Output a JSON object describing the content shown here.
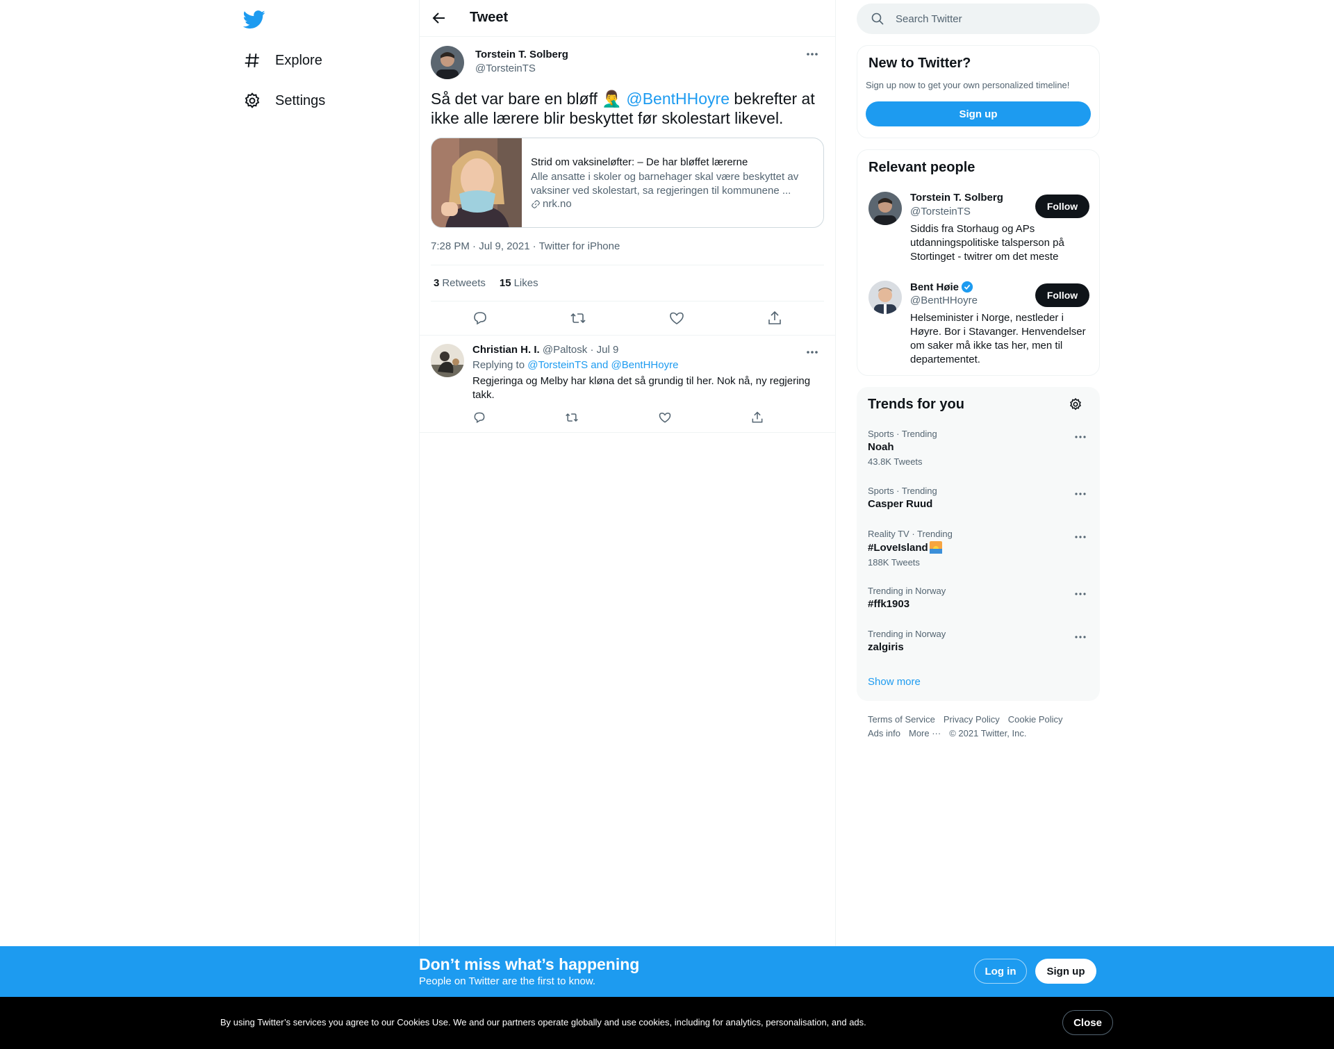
{
  "nav": {
    "logo": "twitter-bird-icon",
    "items": [
      {
        "label": "Explore",
        "icon": "hashtag-icon"
      },
      {
        "label": "Settings",
        "icon": "gear-icon"
      }
    ]
  },
  "header": {
    "title": "Tweet"
  },
  "tweet": {
    "author_name": "Torstein T. Solberg",
    "author_handle": "@TorsteinTS",
    "text_before": "Så det var bare en bløff 🤦‍♂️ ",
    "mention": "@BentHHoyre",
    "text_after": " bekrefter at ikke alle lærere blir beskyttet før skolestart likevel.",
    "card": {
      "title": "Strid om vaksineløfter: – De har bløffet lærerne",
      "description": "Alle ansatte i skoler og barnehager skal være beskyttet av vaksiner ved skolestart, sa regjeringen til kommunene ...",
      "domain": "nrk.no"
    },
    "time": "7:28 PM · Jul 9, 2021",
    "source": "Twitter for iPhone",
    "retweets_count": "3",
    "retweets_label": "Retweets",
    "likes_count": "15",
    "likes_label": "Likes"
  },
  "reply": {
    "author_name": "Christian H. I.",
    "author_handle": "@Paltosk",
    "date": "Jul 9",
    "replying_prefix": "Replying to ",
    "replying_to": "@TorsteinTS and @BentHHoyre",
    "text": "Regjeringa og Melby har kløna det så grundig til her. Nok nå, ny regjering takk."
  },
  "search": {
    "placeholder": "Search Twitter"
  },
  "new_to_twitter": {
    "title": "New to Twitter?",
    "subtitle": "Sign up now to get your own personalized timeline!",
    "signup_label": "Sign up"
  },
  "relevant_people": {
    "title": "Relevant people",
    "follow_label": "Follow",
    "people": [
      {
        "name": "Torstein T. Solberg",
        "handle": "@TorsteinTS",
        "bio": "Siddis fra Storhaug og APs utdanningspolitiske talsperson på Stortinget - twitrer om det meste",
        "verified": false
      },
      {
        "name": "Bent Høie",
        "handle": "@BentHHoyre",
        "bio": "Helseminister i Norge, nestleder i Høyre. Bor i Stavanger. Henvendelser om saker må ikke tas her, men til departementet.",
        "verified": true
      }
    ]
  },
  "trends": {
    "title": "Trends for you",
    "items": [
      {
        "context": "Sports · Trending",
        "name": "Noah",
        "count": "43.8K Tweets"
      },
      {
        "context": "Sports · Trending",
        "name": "Casper Ruud",
        "count": ""
      },
      {
        "context": "Reality TV · Trending",
        "name": "#LoveIsland",
        "count": "188K Tweets"
      },
      {
        "context": "Trending in Norway",
        "name": "#ffk1903",
        "count": ""
      },
      {
        "context": "Trending in Norway",
        "name": "zalgiris",
        "count": ""
      }
    ],
    "show_more": "Show more"
  },
  "footer": {
    "links": [
      "Terms of Service",
      "Privacy Policy",
      "Cookie Policy",
      "Ads info",
      "More ···"
    ],
    "copyright": "© 2021 Twitter, Inc."
  },
  "banner": {
    "title": "Don’t miss what’s happening",
    "subtitle": "People on Twitter are the first to know.",
    "login_label": "Log in",
    "signup_label": "Sign up"
  },
  "cookie": {
    "text": "By using Twitter’s services you agree to our Cookies Use. We and our partners operate globally and use cookies, including for analytics, personalisation, and ads.",
    "close_label": "Close"
  },
  "colors": {
    "accent": "#1d9bf0",
    "text": "#0f1419",
    "muted": "#536471",
    "border": "#eff3f4"
  }
}
